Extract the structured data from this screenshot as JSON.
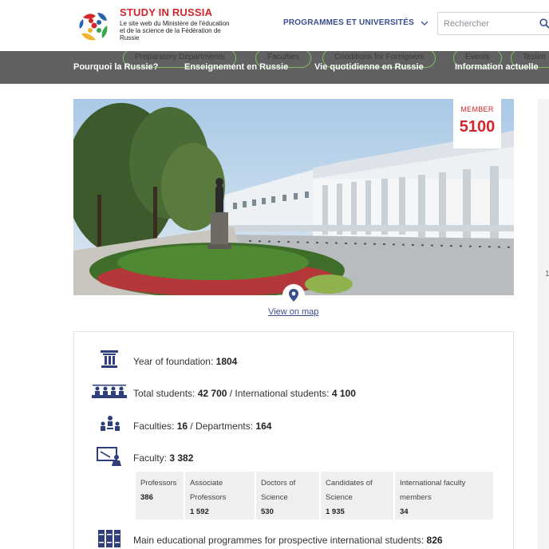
{
  "header": {
    "logo_title": "STUDY IN RUSSIA",
    "logo_subtitle": "Le site web du Ministère de l'éducation et de la science de la Fédération de Russie",
    "nav_programmes": "PROGRAMMES ET UNIVERSITÉS",
    "search_placeholder": "Rechercher"
  },
  "menubar": {
    "pills": [
      "Preparatory Departments",
      "Faculties",
      "Conditions for Foreigners",
      "Events",
      "Testim"
    ],
    "items": [
      "Pourquoi la Russie?",
      "Enseignement en Russie",
      "Vie quotidienne en Russie",
      "Information actuelle"
    ]
  },
  "badge": {
    "label": "MEMBER",
    "number": "5100"
  },
  "map": {
    "link": "View on map"
  },
  "right": {
    "num": "1"
  },
  "stats": {
    "foundation_label": "Year of foundation: ",
    "foundation_value": "1804",
    "total_label": "Total students: ",
    "total_value": "42 700",
    "intl_label": " / International students: ",
    "intl_value": "4 100",
    "faculties_label": "Faculties: ",
    "faculties_value": "16",
    "departments_label": " / Departments: ",
    "departments_value": "164",
    "faculty_label": "Faculty: ",
    "faculty_value": "3 382",
    "programmes_label": "Main educational programmes for prospective international students: ",
    "programmes_value": "826"
  },
  "faculty_table": [
    {
      "label": "Professors",
      "value": "386"
    },
    {
      "label": "Associate Professors",
      "value": "1 592"
    },
    {
      "label": "Doctors of Science",
      "value": "530"
    },
    {
      "label": "Candidates of Science",
      "value": "1 935"
    },
    {
      "label": "International faculty members",
      "value": "34"
    }
  ],
  "colors": {
    "brand_red": "#d1262c",
    "nav_blue": "#3a4d8f",
    "menubar": "#616161",
    "pill_border": "#7dbd5d",
    "icon_navy": "#2e3f7c"
  }
}
